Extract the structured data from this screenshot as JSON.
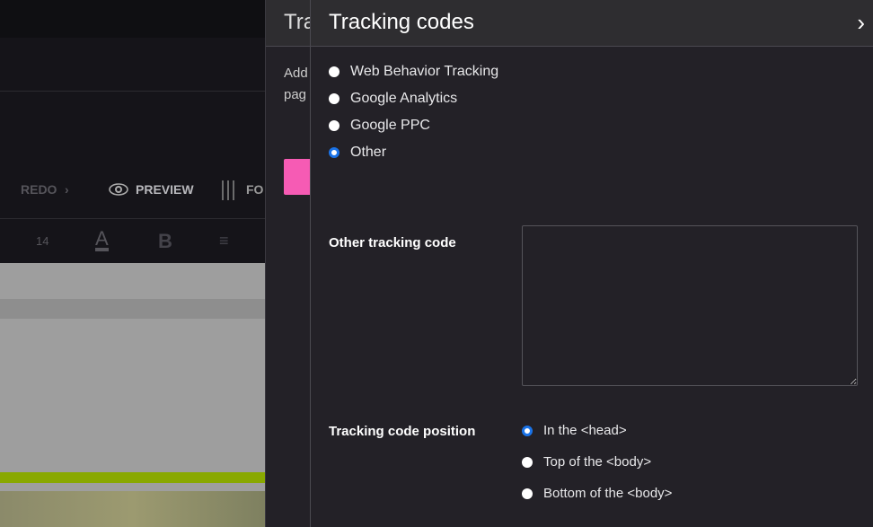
{
  "editor": {
    "redo": "REDO",
    "preview": "PREVIEW",
    "format_partial": "FO",
    "font_size": "14"
  },
  "middle": {
    "title_partial": "Tra",
    "text_partial_1": "Add",
    "text_partial_2": "pag",
    "accent": "#f65bb4"
  },
  "panel": {
    "title": "Tracking codes",
    "tracking_options": [
      {
        "label": "Web Behavior Tracking",
        "selected": false
      },
      {
        "label": "Google Analytics",
        "selected": false
      },
      {
        "label": "Google PPC",
        "selected": false
      },
      {
        "label": "Other",
        "selected": true
      }
    ],
    "other_code_label": "Other tracking code",
    "other_code_value": "",
    "position_label": "Tracking code position",
    "position_options": [
      {
        "label": "In the <head>",
        "selected": true
      },
      {
        "label": "Top of the <body>",
        "selected": false
      },
      {
        "label": "Bottom of the <body>",
        "selected": false
      }
    ]
  }
}
